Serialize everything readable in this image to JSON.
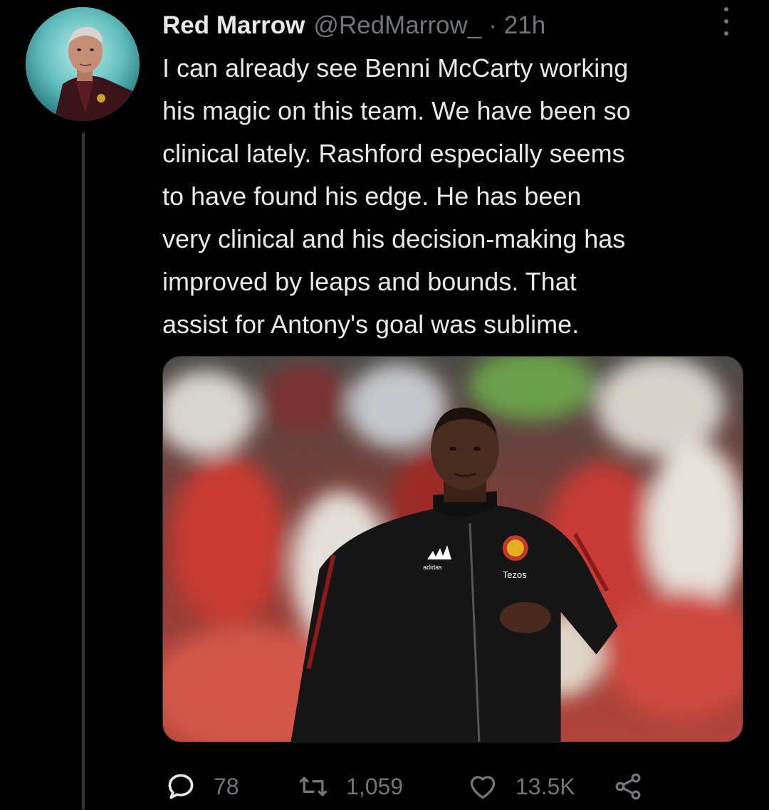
{
  "tweet": {
    "display_name": "Red Marrow",
    "handle": "@RedMarrow_",
    "separator": "·",
    "time": "21h",
    "text_lines": [
      "I can already see Benni McCarty working",
      "his magic on this team. We have been so",
      "clinical lately. Rashford especially seems",
      "to have found his edge. He has been",
      "very clinical and his decision-making has",
      "improved by leaps and bounds. That",
      "assist for Antony's goal was sublime."
    ],
    "media": {
      "jacket_brand": "adidas",
      "sponsor": "Tezos"
    },
    "stats": {
      "replies": "78",
      "retweets": "1,059",
      "likes": "13.5K"
    }
  },
  "icons": {
    "more": "more-icon",
    "reply": "reply-icon",
    "retweet": "retweet-icon",
    "like": "heart-icon",
    "share": "share-icon"
  },
  "colors": {
    "background": "#000000",
    "text": "#e7e9ea",
    "secondary": "#71767b",
    "thread_line": "#333639"
  }
}
